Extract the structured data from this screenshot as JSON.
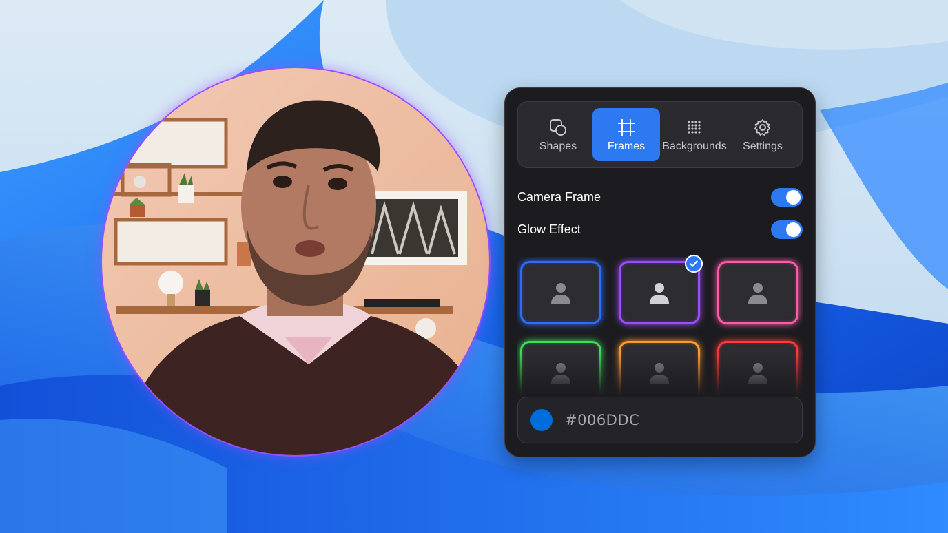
{
  "tabs": [
    {
      "label": "Shapes",
      "icon": "shapes-icon",
      "active": false
    },
    {
      "label": "Frames",
      "icon": "crop-frame-icon",
      "active": true
    },
    {
      "label": "Backgrounds",
      "icon": "dot-grid-icon",
      "active": false
    },
    {
      "label": "Settings",
      "icon": "gear-icon",
      "active": false
    }
  ],
  "toggles": {
    "camera_frame": {
      "label": "Camera Frame",
      "on": true
    },
    "glow_effect": {
      "label": "Glow Effect",
      "on": true
    }
  },
  "frames": [
    {
      "color": "#2f6bff",
      "selected": false
    },
    {
      "color": "#9d4dff",
      "selected": true
    },
    {
      "color": "#ff5aa8",
      "selected": false
    },
    {
      "color": "#3ddc5a",
      "selected": false
    },
    {
      "color": "#ff9a2e",
      "selected": false
    },
    {
      "color": "#ff3a3a",
      "selected": false
    }
  ],
  "color": {
    "hex": "#006DDC"
  },
  "theme": {
    "accent": "#2d79f2",
    "panel": "#1c1c20"
  }
}
